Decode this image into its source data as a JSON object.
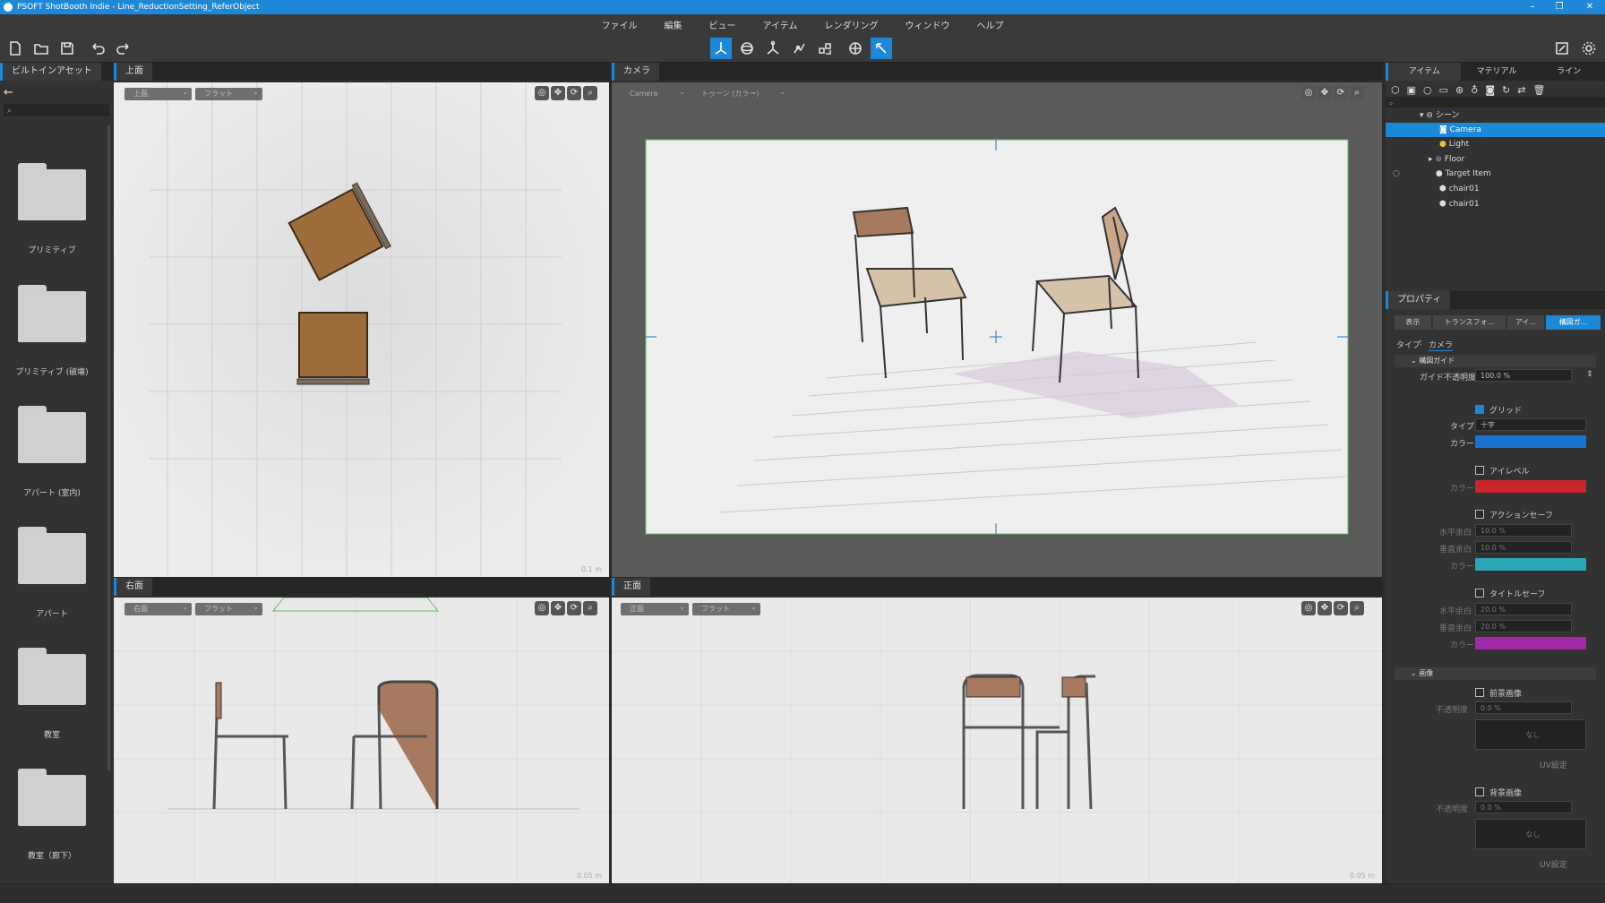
{
  "app": {
    "title": "PSOFT ShotBooth Indie - Line_ReductionSetting_ReferObject",
    "accent": "#1e88d8"
  },
  "menu": [
    "ファイル",
    "編集",
    "ビュー",
    "アイテム",
    "レンダリング",
    "ウィンドウ",
    "ヘルプ"
  ],
  "left_panel": {
    "tab": "ビルトインアセット",
    "folders": [
      "プリミティブ",
      "プリミティブ (破壊)",
      "アパート (室内)",
      "アパート",
      "教室",
      "教室（廊下）"
    ]
  },
  "viewports": {
    "top": {
      "tab": "上面",
      "view": "上面",
      "shade": "フラット",
      "scale": "0.1 m"
    },
    "camera": {
      "tab": "カメラ",
      "view": "Camera",
      "shade": "トゥーン (カラー)"
    },
    "right_side": {
      "tab": "右面",
      "view": "右面",
      "shade": "フラット",
      "scale": "0.05 m"
    },
    "front": {
      "tab": "正面",
      "view": "正面",
      "shade": "フラット",
      "scale": "0.05 m"
    }
  },
  "right_panel": {
    "tabs": [
      "アイテム",
      "マテリアル",
      "ライン"
    ],
    "tree": [
      {
        "label": "シーン",
        "icon": "scene-icon"
      },
      {
        "label": "Camera",
        "icon": "camera-icon",
        "selected": true
      },
      {
        "label": "Light",
        "icon": "light-icon"
      },
      {
        "label": "Floor",
        "icon": "floor-icon"
      },
      {
        "label": "Target Item",
        "icon": "target-icon"
      },
      {
        "label": "chair01",
        "icon": "cube-icon"
      },
      {
        "label": "chair01",
        "icon": "cube-icon"
      }
    ],
    "props_tab": "プロパティ",
    "props_subtabs": [
      "表示",
      "トランスフォ...",
      "アイ...",
      "構図ガ..."
    ],
    "type_label": "タイプ",
    "type_value": "カメラ",
    "guide_section": "構図ガイド",
    "guide_opacity_label": "ガイド不透明度",
    "guide_opacity": "100.0 %",
    "grid": {
      "label": "グリッド",
      "checked": true,
      "type_label": "タイプ",
      "type": "十字",
      "color_label": "カラー",
      "color": "#1874d0"
    },
    "eyelevel": {
      "label": "アイレベル",
      "checked": false,
      "color_label": "カラー",
      "color": "#c9252c"
    },
    "action_safe": {
      "label": "アクションセーフ",
      "checked": false,
      "h_label": "水平余白",
      "h": "10.0 %",
      "v_label": "垂直余白",
      "v": "10.0 %",
      "color_label": "カラー",
      "color": "#2aa8b8"
    },
    "title_safe": {
      "label": "タイトルセーフ",
      "checked": false,
      "h_label": "水平余白",
      "h": "20.0 %",
      "v_label": "垂直余白",
      "v": "20.0 %",
      "color_label": "カラー",
      "color": "#a02aa8"
    },
    "image_section": "画像",
    "fg_image": {
      "label": "前景画像",
      "opacity_label": "不透明度",
      "opacity": "0.0 %",
      "select": "なし",
      "uv": "UV設定"
    },
    "bg_image": {
      "label": "背景画像",
      "opacity_label": "不透明度",
      "opacity": "0.0 %",
      "select": "なし",
      "uv": "UV設定"
    }
  }
}
